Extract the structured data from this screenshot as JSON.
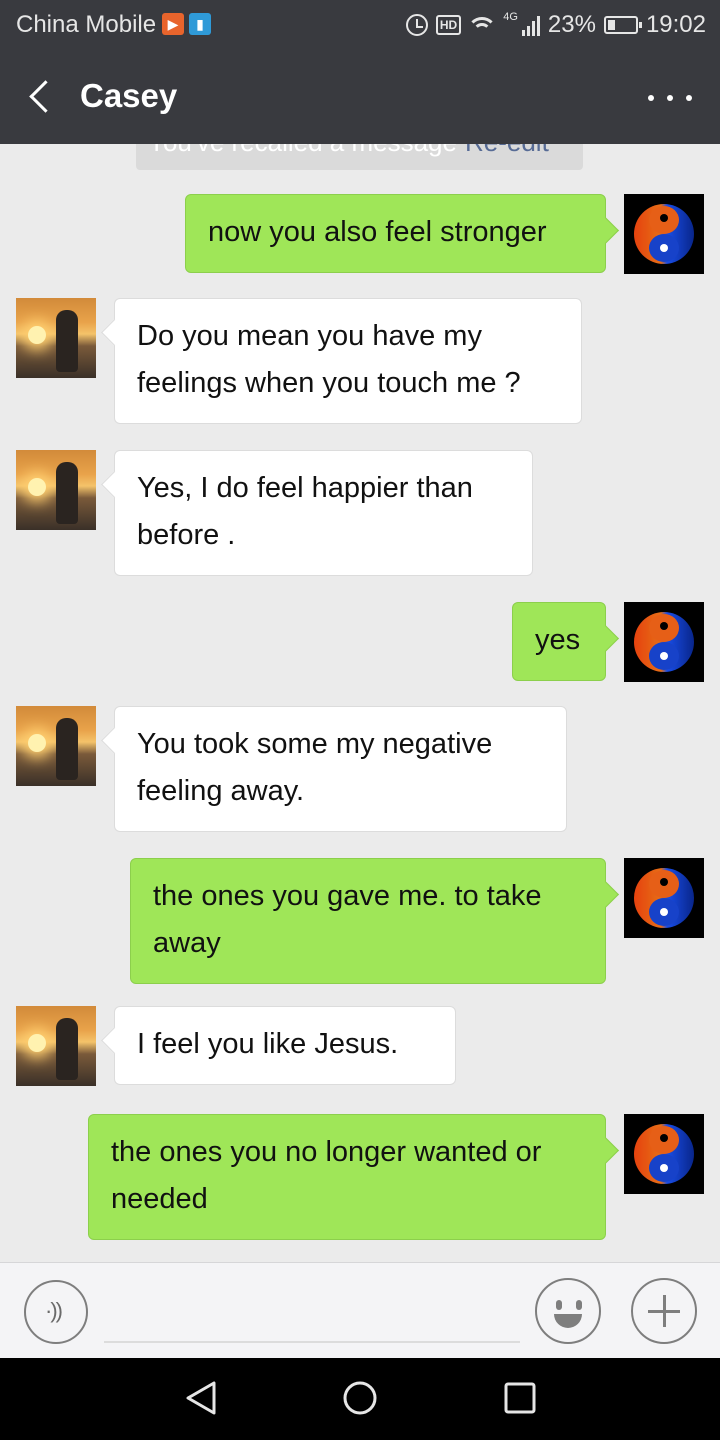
{
  "status_bar": {
    "carrier": "China Mobile",
    "hd": "HD",
    "network": "4G",
    "battery": "23%",
    "time": "19:02"
  },
  "header": {
    "title": "Casey",
    "back_icon": "chevron-left-icon",
    "more_icon": "more-dots-icon"
  },
  "system_notice": {
    "text": "You've recalled a message",
    "action": "Re-edit"
  },
  "messages": [
    {
      "from": "me",
      "text": "now you also feel stronger"
    },
    {
      "from": "contact",
      "text": "Do you mean you have my feelings when you touch me ?"
    },
    {
      "from": "contact",
      "text": "Yes, I do feel happier than before ."
    },
    {
      "from": "me",
      "text": "yes"
    },
    {
      "from": "contact",
      "text": "You took  some my negative feeling away."
    },
    {
      "from": "me",
      "text": "the ones you gave me. to take away"
    },
    {
      "from": "contact",
      "text": "I feel you like Jesus."
    },
    {
      "from": "me",
      "text": "the ones you no longer wanted or needed"
    }
  ],
  "input_bar": {
    "text_value": "",
    "voice_icon": "voice-icon",
    "emoji_icon": "emoji-icon",
    "plus_icon": "plus-icon"
  },
  "colors": {
    "header_bg": "#393a3f",
    "chat_bg": "#ebebeb",
    "outgoing_bubble": "#9fe658",
    "incoming_bubble": "#ffffff",
    "link": "#576b95"
  }
}
